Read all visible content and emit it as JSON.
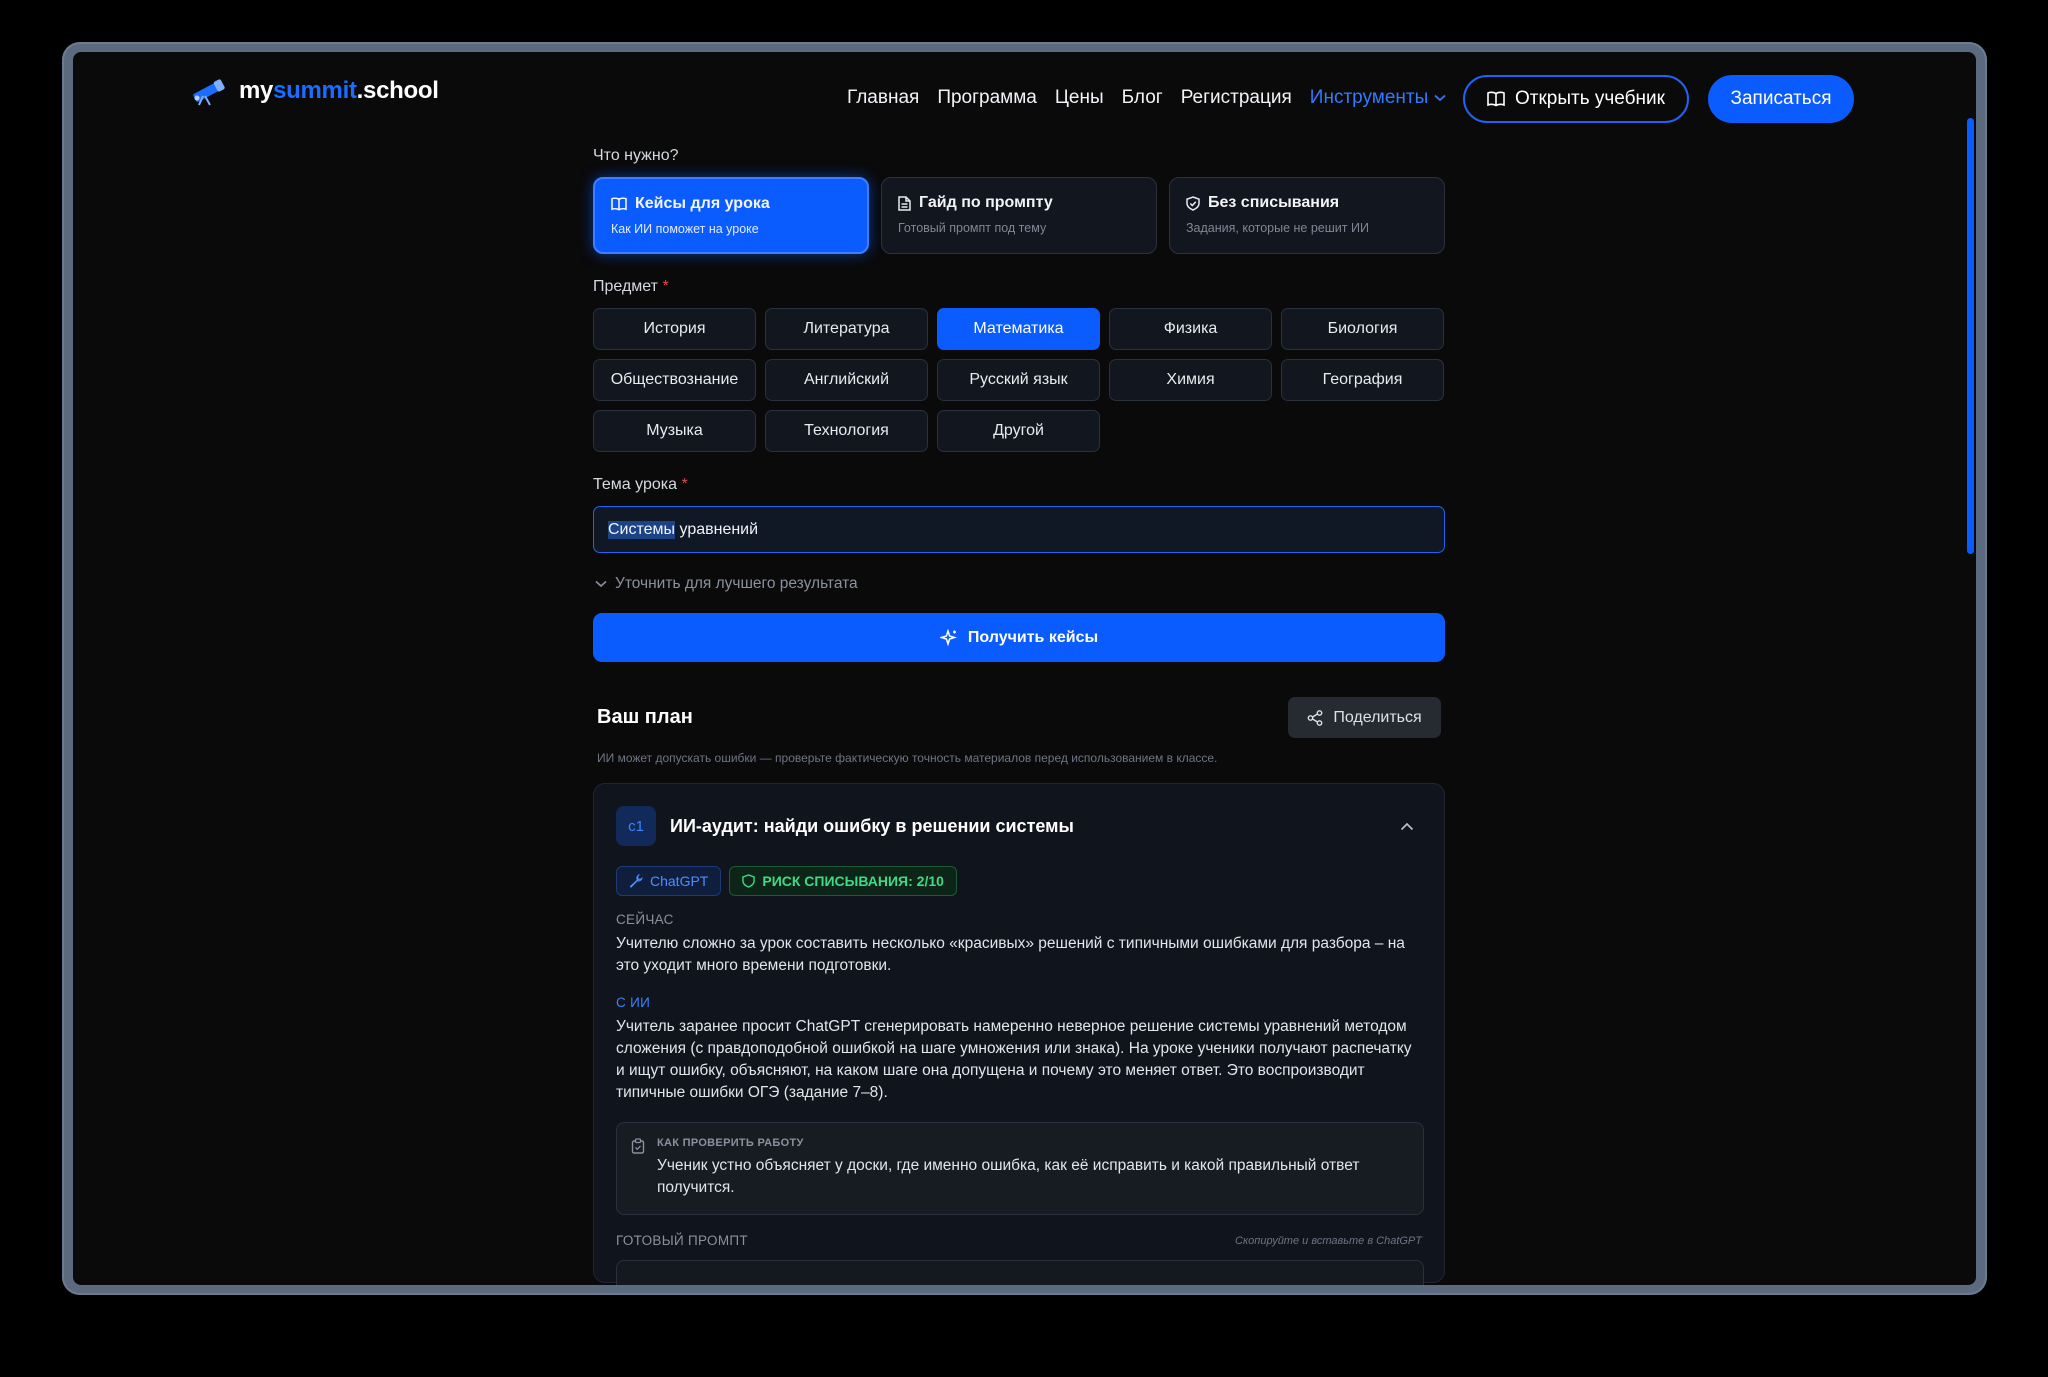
{
  "brand": {
    "part1": "my",
    "part2": "summit",
    "part3": ".school"
  },
  "nav": {
    "items": [
      "Главная",
      "Программа",
      "Цены",
      "Блог",
      "Регистрация"
    ],
    "tools": "Инструменты",
    "open_book": "Открыть учебник",
    "signup": "Записаться"
  },
  "form": {
    "need_label": "Что нужно?",
    "modes": [
      {
        "title": "Кейсы для урока",
        "subtitle": "Как ИИ поможет на уроке",
        "active": true
      },
      {
        "title": "Гайд по промпту",
        "subtitle": "Готовый промпт под тему",
        "active": false
      },
      {
        "title": "Без списывания",
        "subtitle": "Задания, которые не решит ИИ",
        "active": false
      }
    ],
    "subject_label": "Предмет",
    "required_mark": "*",
    "subjects": [
      "История",
      "Литература",
      "Математика",
      "Физика",
      "Биология",
      "Обществознание",
      "Английский",
      "Русский язык",
      "Химия",
      "География",
      "Музыка",
      "Технология",
      "Другой"
    ],
    "selected_subject": "Математика",
    "topic_label": "Тема урока",
    "topic_value_selected": "Системы",
    "topic_value_rest": " уравнений",
    "refine": "Уточнить для лучшего результата",
    "submit": "Получить кейсы"
  },
  "plan": {
    "title": "Ваш план",
    "share": "Поделиться",
    "disclaimer": "ИИ может допускать ошибки — проверьте фактическую точность материалов перед использованием в классе.",
    "card": {
      "badge": "c1",
      "title": "ИИ-аудит: найди ошибку в решении системы",
      "tool_tag": "ChatGPT",
      "risk_tag": "РИСК СПИСЫВАНИЯ: 2/10",
      "now_label": "СЕЙЧАС",
      "now_text": "Учителю сложно за урок составить несколько «красивых» решений с типичными ошибками для разбора – на это уходит много времени подготовки.",
      "ai_label": "С ИИ",
      "ai_text": "Учитель заранее просит ChatGPT сгенерировать намеренно неверное решение системы уравнений методом сложения (с правдоподобной ошибкой на шаге умножения или знака). На уроке ученики получают распечатку и ищут ошибку, объясняют, на каком шаге она допущена и почему это меняет ответ. Это воспроизводит типичные ошибки ОГЭ (задание 7–8).",
      "check_label": "КАК ПРОВЕРИТЬ РАБОТУ",
      "check_text": "Ученик устно объясняет у доски, где именно ошибка, как её исправить и какой правильный ответ получится.",
      "prompt_label": "ГОТОВЫЙ ПРОМПТ",
      "prompt_hint": "Скопируйте и вставьте в ChatGPT"
    }
  },
  "colors": {
    "accent": "#0a5cff",
    "background": "#0a0a0b",
    "success": "#3ddc84",
    "required": "#e5484d"
  }
}
